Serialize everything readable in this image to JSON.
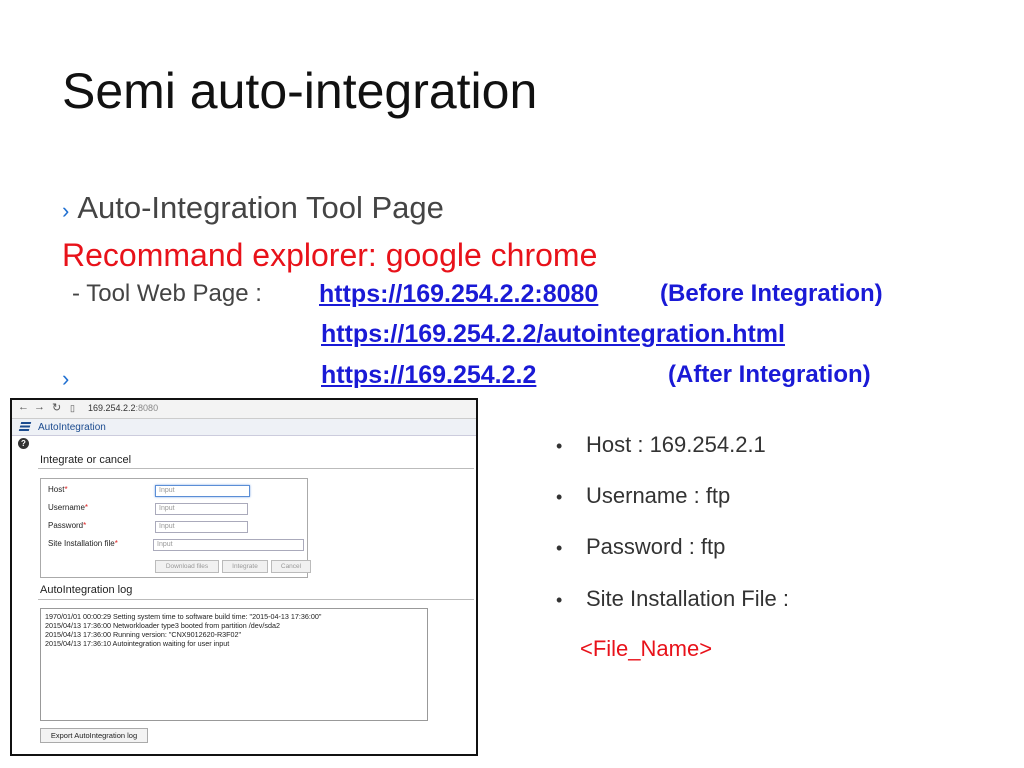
{
  "slide": {
    "title": "Semi auto-integration",
    "bullet_glyph": "›",
    "bullet1": "Auto-Integration Tool Page",
    "recommend": "Recommand explorer: google chrome",
    "tool_web_label": " - Tool Web Page : ",
    "url_before": "https://169.254.2.2:8080",
    "note_before": "(Before Integration)",
    "url_autointegration": "https://169.254.2.2/autointegration.html",
    "url_after": "https://169.254.2.2",
    "note_after": "(After Integration)"
  },
  "screenshot": {
    "address": "169.254.2.2",
    "address_port": ":8080",
    "app_name": "AutoIntegration",
    "section1": "Integrate or cancel",
    "fields": [
      {
        "label": "Host",
        "placeholder": "Input"
      },
      {
        "label": "Username",
        "placeholder": "Input"
      },
      {
        "label": "Password",
        "placeholder": "Input"
      },
      {
        "label": "Site Installation file",
        "placeholder": "Input"
      }
    ],
    "required_mark": "*",
    "buttons": {
      "download": "Download files",
      "integrate": "Integrate",
      "cancel": "Cancel"
    },
    "section2": "AutoIntegration log",
    "log_lines": [
      "1970/01/01 00:00:29 Setting system time to software build time: \"2015-04-13 17:36:00\"",
      "2015/04/13 17:36:00 Networkloader type3 booted from partition /dev/sda2",
      "2015/04/13 17:36:00 Running version: \"CNX9012620-R3F02\"",
      "2015/04/13 17:36:10 Autointegration waiting for user input"
    ],
    "export_button": "Export AutoIntegration log"
  },
  "credentials": {
    "items": [
      "Host : 169.254.2.1",
      "Username : ftp",
      "Password : ftp",
      "Site Installation File :"
    ],
    "file_name": "<File_Name>",
    "bullet_dot": "•"
  }
}
